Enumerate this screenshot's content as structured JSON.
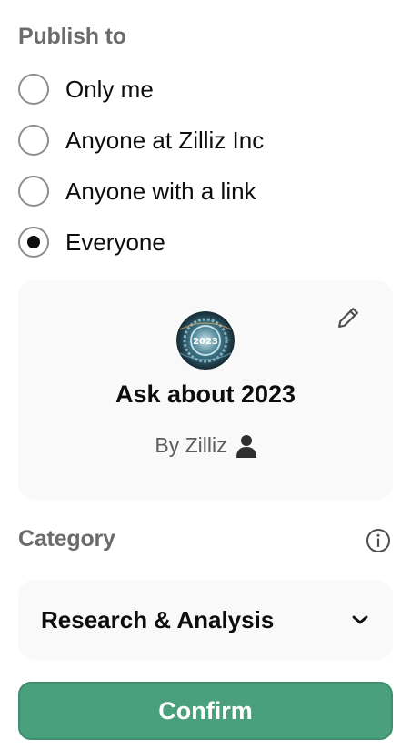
{
  "publish": {
    "label": "Publish to",
    "options": [
      {
        "label": "Only me",
        "selected": false
      },
      {
        "label": "Anyone at Zilliz Inc",
        "selected": false
      },
      {
        "label": "Anyone with a link",
        "selected": false
      },
      {
        "label": "Everyone",
        "selected": true
      }
    ]
  },
  "gpt": {
    "name": "Ask about 2023",
    "author": "By Zilliz",
    "avatar_text": "2023",
    "edit_icon": "pencil-icon",
    "author_icon": "person-icon"
  },
  "category": {
    "label": "Category",
    "info_icon": "info-icon",
    "value": "Research & Analysis",
    "dropdown_icon": "chevron-down-icon"
  },
  "confirm": {
    "label": "Confirm",
    "color": "#4aa07c"
  }
}
